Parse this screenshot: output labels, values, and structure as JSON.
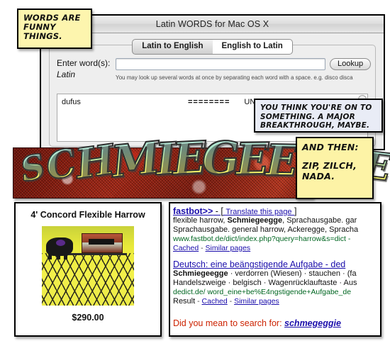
{
  "app": {
    "title": "Latin WORDS for Mac OS X",
    "tabs": [
      {
        "label": "Latin to English",
        "active": true
      },
      {
        "label": "English to Latin",
        "active": false
      }
    ],
    "form": {
      "enter_label": "Enter word(s):",
      "sub_label": "Latin",
      "input_value": "",
      "input_placeholder": "",
      "hint": "You may look up several words at once by separating each word with a space. e.g. disco disca",
      "lookup_label": "Lookup"
    },
    "result": {
      "word": "dufus",
      "separator": "========",
      "status": "UNKNOWN"
    }
  },
  "graffiti": {
    "text": "SCHMIEGEEGGE?",
    "letters": [
      "S",
      "C",
      "H",
      "M",
      "I",
      "E",
      "G",
      "E",
      "E",
      "G",
      "G",
      "E",
      "?"
    ],
    "fill_top": "#bfe8e4",
    "fill_bottom": "#eae85f",
    "background": "#8b1c10"
  },
  "captions": {
    "words_are_funny": "WORDS ARE FUNNY THINGS.",
    "breakthrough": "YOU THINK YOU'RE ON TO SOMETHING. A MAJOR BREAKTHROUGH, MAYBE.",
    "and_then": "AND THEN:",
    "zip_zilch_nada": "ZIP, ZILCH, NADA.",
    "yellow": "#fdf3a6",
    "lavender": "#e9ecf6"
  },
  "product": {
    "title": "4' Concord Flexible Harrow",
    "price": "$290.00"
  },
  "search": {
    "results": [
      {
        "title": "fastbot>>",
        "title_suffix": " - [ ",
        "translate_label": "Translate this page",
        "title_suffix_end": " ]",
        "snippet_line1_pre": "flexible harrow, ",
        "snippet_line1_bold": "Schmiegeegge",
        "snippet_line1_post": ", Sprachausgabe. gar",
        "snippet_line2": "Sprachausgabe. general harrow, Ackeregge, Spracha",
        "url": "www.fastbot.de/dict/index.php?query=harrow&s=dict -",
        "cached_label": "Cached",
        "sep": " - ",
        "similar_label": "Similar pages"
      },
      {
        "title": "Deutsch: eine beängstigende Aufgabe - ded",
        "snippet_line1_bold": "Schmiegeegge",
        "snippet_line1_post": " · verdorren (Wiesen) · stauchen · (fa",
        "snippet_line2": "Handelszweige · belgisch · Wagenrücklauftaste · Aus",
        "url": "dedict.de/ word_eine+be%E4ngstigende+Aufgabe_de",
        "result_label": "Result",
        "cached_label": "Cached",
        "sep": " - ",
        "similar_label": "Similar pages"
      }
    ],
    "did_you_mean_prefix": "Did you mean to search for: ",
    "did_you_mean_term": "schmegeggie"
  }
}
